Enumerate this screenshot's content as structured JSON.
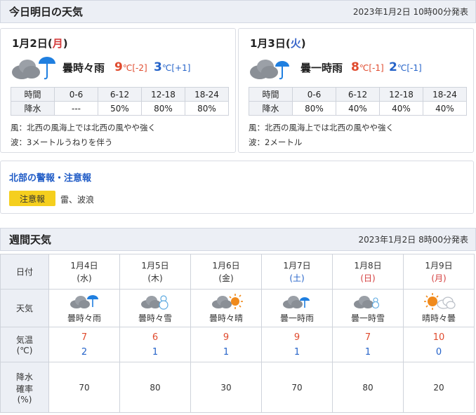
{
  "today": {
    "title": "今日明日の天気",
    "stamp": "2023年1月2日  10時00分発表",
    "days": [
      {
        "date": "1月2日",
        "weekday": "月",
        "condition": "曇時々雨",
        "high": "9",
        "high_diff": "[-2]",
        "low": "3",
        "low_diff": "[+1]",
        "rain_label": "降水",
        "time_label": "時間",
        "periods": [
          "0-6",
          "6-12",
          "12-18",
          "18-24"
        ],
        "rain": [
          "---",
          "50%",
          "80%",
          "80%"
        ],
        "wind": "風：北西の風海上では北西の風やや強く",
        "wave": "波：3メートルうねりを伴う"
      },
      {
        "date": "1月3日",
        "weekday": "火",
        "condition": "曇一時雨",
        "high": "8",
        "high_diff": "[-1]",
        "low": "2",
        "low_diff": "[-1]",
        "rain_label": "降水",
        "time_label": "時間",
        "periods": [
          "0-6",
          "6-12",
          "12-18",
          "18-24"
        ],
        "rain": [
          "80%",
          "40%",
          "40%",
          "40%"
        ],
        "wind": "風：北西の風海上では北西の風やや強く",
        "wave": "波：2メートル"
      }
    ],
    "unit": "℃"
  },
  "warning": {
    "title": "北部の警報・注意報",
    "badge": "注意報",
    "text": "雷、波浪"
  },
  "weekly": {
    "title": "週間天気",
    "stamp": "2023年1月2日  8時00分発表",
    "row_labels": {
      "date": "日付",
      "weather": "天気",
      "temp_line1": "気温",
      "temp_line2": "(℃)",
      "pop_line1": "降水",
      "pop_line2": "確率",
      "pop_line3": "(%)"
    },
    "days": [
      {
        "date": "1月4日",
        "weekday": "(水)",
        "condition": "曇時々雨",
        "icon": "cloud-umbrella-icon",
        "high": "7",
        "low": "2",
        "pop": "70"
      },
      {
        "date": "1月5日",
        "weekday": "(木)",
        "condition": "曇時々雪",
        "icon": "cloud-snowman-icon",
        "high": "6",
        "low": "1",
        "pop": "80"
      },
      {
        "date": "1月6日",
        "weekday": "(金)",
        "condition": "曇時々晴",
        "icon": "cloud-sun-icon",
        "high": "9",
        "low": "1",
        "pop": "30"
      },
      {
        "date": "1月7日",
        "weekday": "(土)",
        "condition": "曇一時雨",
        "icon": "cloud-umbrella-icon",
        "high": "9",
        "low": "1",
        "pop": "70"
      },
      {
        "date": "1月8日",
        "weekday": "(日)",
        "condition": "曇一時雪",
        "icon": "cloud-snowman-icon",
        "high": "7",
        "low": "1",
        "pop": "80"
      },
      {
        "date": "1月9日",
        "weekday": "(月)",
        "condition": "晴時々曇",
        "icon": "sun-cloud-icon",
        "high": "10",
        "low": "0",
        "pop": "20"
      }
    ]
  },
  "colors": {
    "high": "#e04b2e",
    "low": "#2563c9",
    "badge": "#f5cf1e",
    "header_bg": "#eceff5"
  }
}
